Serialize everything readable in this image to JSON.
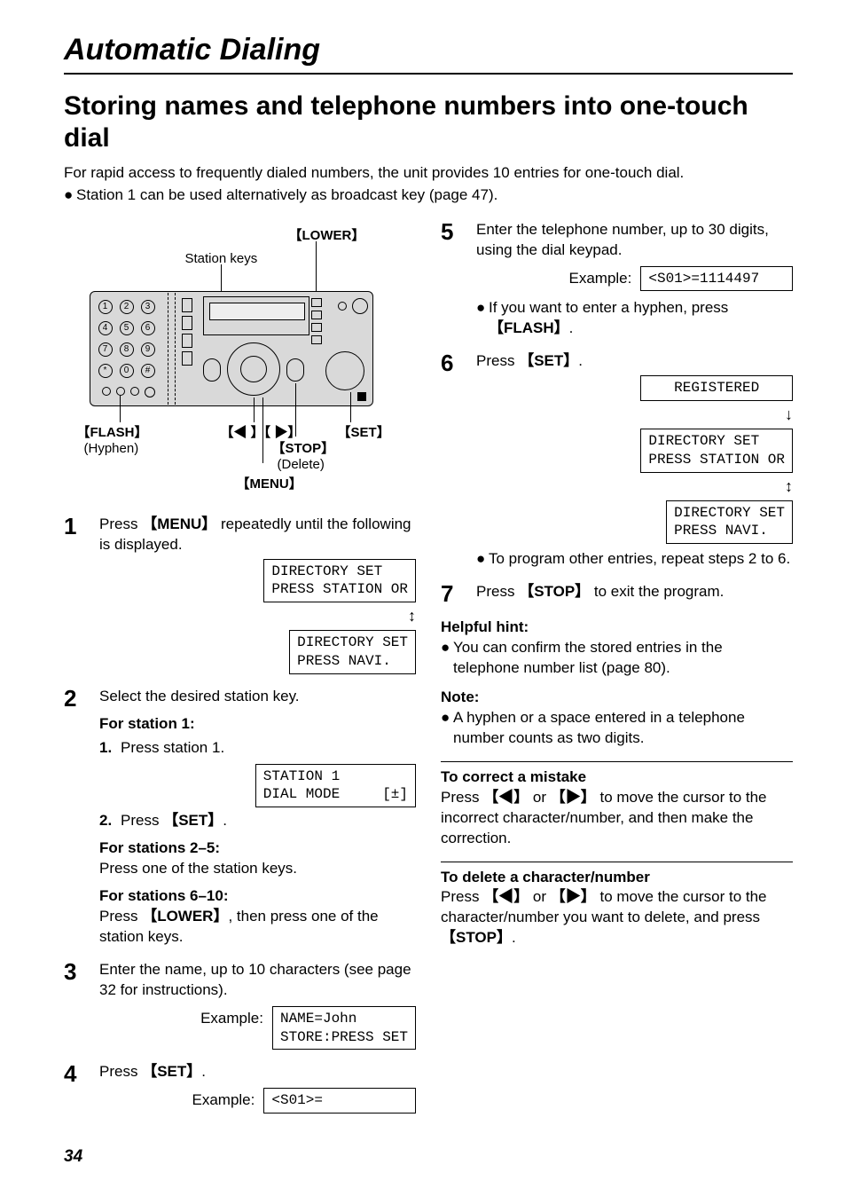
{
  "chapter": "Automatic Dialing",
  "section_title": "Storing names and telephone numbers into one-touch dial",
  "intro": "For rapid access to frequently dialed numbers, the unit provides 10 entries for one-touch dial.",
  "intro_bullet": "Station 1 can be used alternatively as broadcast key (page 47).",
  "figure": {
    "lower": "LOWER",
    "station_keys": "Station keys",
    "flash": "FLASH",
    "hyphen": "(Hyphen)",
    "arrows": "◀ 】【 ▶",
    "set": "SET",
    "stop": "STOP",
    "delete": "(Delete)",
    "menu": "MENU",
    "keys": [
      "1",
      "2",
      "3",
      "4",
      "5",
      "6",
      "7",
      "8",
      "9",
      "*",
      "0",
      "#"
    ]
  },
  "steps_left": {
    "s1": {
      "text_a": "Press ",
      "key": "MENU",
      "text_b": " repeatedly until the following is displayed.",
      "lcd1": "DIRECTORY SET\nPRESS STATION OR",
      "lcd2": "DIRECTORY SET\nPRESS NAVI."
    },
    "s2": {
      "text": "Select the desired station key.",
      "for1_label": "For station 1:",
      "for1_item_n": "1.",
      "for1_item": "Press station 1.",
      "for1_lcd": "STATION 1\nDIAL MODE     [±]",
      "for1_item2_n": "2.",
      "for1_item2_a": "Press ",
      "for1_item2_key": "SET",
      "for1_item2_b": ".",
      "for2_label": "For stations 2–5:",
      "for2_text": "Press one of the station keys.",
      "for3_label": "For stations 6–10:",
      "for3_text_a": "Press ",
      "for3_key": "LOWER",
      "for3_text_b": ", then press one of the station keys."
    },
    "s3": {
      "text": "Enter the name, up to 10 characters (see page 32 for instructions).",
      "ex_label": "Example:",
      "ex_lcd": "NAME=John\nSTORE:PRESS SET"
    },
    "s4": {
      "text_a": "Press ",
      "key": "SET",
      "text_b": ".",
      "ex_label": "Example:",
      "ex_lcd": "<S01>=          "
    }
  },
  "steps_right": {
    "s5": {
      "text": "Enter the telephone number, up to 30 digits, using the dial keypad.",
      "ex_label": "Example:",
      "ex_lcd": "<S01>=1114497   ",
      "bullet_a": "If you want to enter a hyphen, press ",
      "bullet_key": "FLASH",
      "bullet_b": "."
    },
    "s6": {
      "text_a": "Press ",
      "key": "SET",
      "text_b": ".",
      "lcd1": "   REGISTERED   ",
      "lcd2": "DIRECTORY SET\nPRESS STATION OR",
      "lcd3": "DIRECTORY SET\nPRESS NAVI.",
      "bullet": "To program other entries, repeat steps 2 to 6."
    },
    "s7": {
      "text_a": "Press ",
      "key": "STOP",
      "text_b": " to exit the program."
    }
  },
  "hint_label": "Helpful hint:",
  "hint_bullet": "You can confirm the stored entries in the telephone number list (page 80).",
  "note_label": "Note:",
  "note_bullet": "A hyphen or a space entered in a telephone number counts as two digits.",
  "correct_label": "To correct a mistake",
  "correct_text_a": "Press ",
  "correct_text_b": " or ",
  "correct_text_c": " to move the cursor to the incorrect character/number, and then make the correction.",
  "delete_label": "To delete a character/number",
  "delete_text_a": "Press ",
  "delete_text_b": " or ",
  "delete_text_c": " to move the cursor to the character/number you want to delete, and press ",
  "delete_key": "STOP",
  "delete_text_d": ".",
  "key_left": "◀",
  "key_right": "▶",
  "page_number": "34"
}
